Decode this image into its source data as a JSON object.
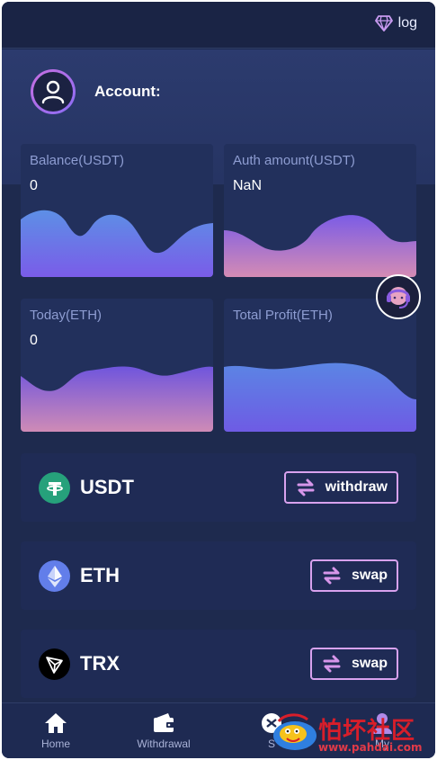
{
  "topbar": {
    "log_label": "log"
  },
  "header": {
    "account_label": "Account:"
  },
  "stats": [
    {
      "title": "Balance(USDT)",
      "value": "0"
    },
    {
      "title": "Auth amount(USDT)",
      "value": "NaN"
    },
    {
      "title": "Today(ETH)",
      "value": "0"
    },
    {
      "title": "Total Profit(ETH)",
      "value": ""
    }
  ],
  "coins": [
    {
      "name": "USDT",
      "action": "withdraw",
      "color": "#26a17b",
      "icon": "tether-icon"
    },
    {
      "name": "ETH",
      "action": "swap",
      "color": "#627eea",
      "icon": "ethereum-icon"
    },
    {
      "name": "TRX",
      "action": "swap",
      "color": "#000000",
      "icon": "tron-icon"
    }
  ],
  "bottom_nav": [
    {
      "label": "Home",
      "icon": "home-icon"
    },
    {
      "label": "Withdrawal",
      "icon": "wallet-icon"
    },
    {
      "label": "S",
      "icon": "share-icon"
    },
    {
      "label": "My",
      "icon": "user-icon"
    }
  ],
  "watermark": {
    "text": "怕坏社区",
    "url": "www.pahdai.com"
  },
  "colors": {
    "accent_border": "#d8a2ee",
    "background": "#1e2a4e",
    "card": "#22305c"
  }
}
